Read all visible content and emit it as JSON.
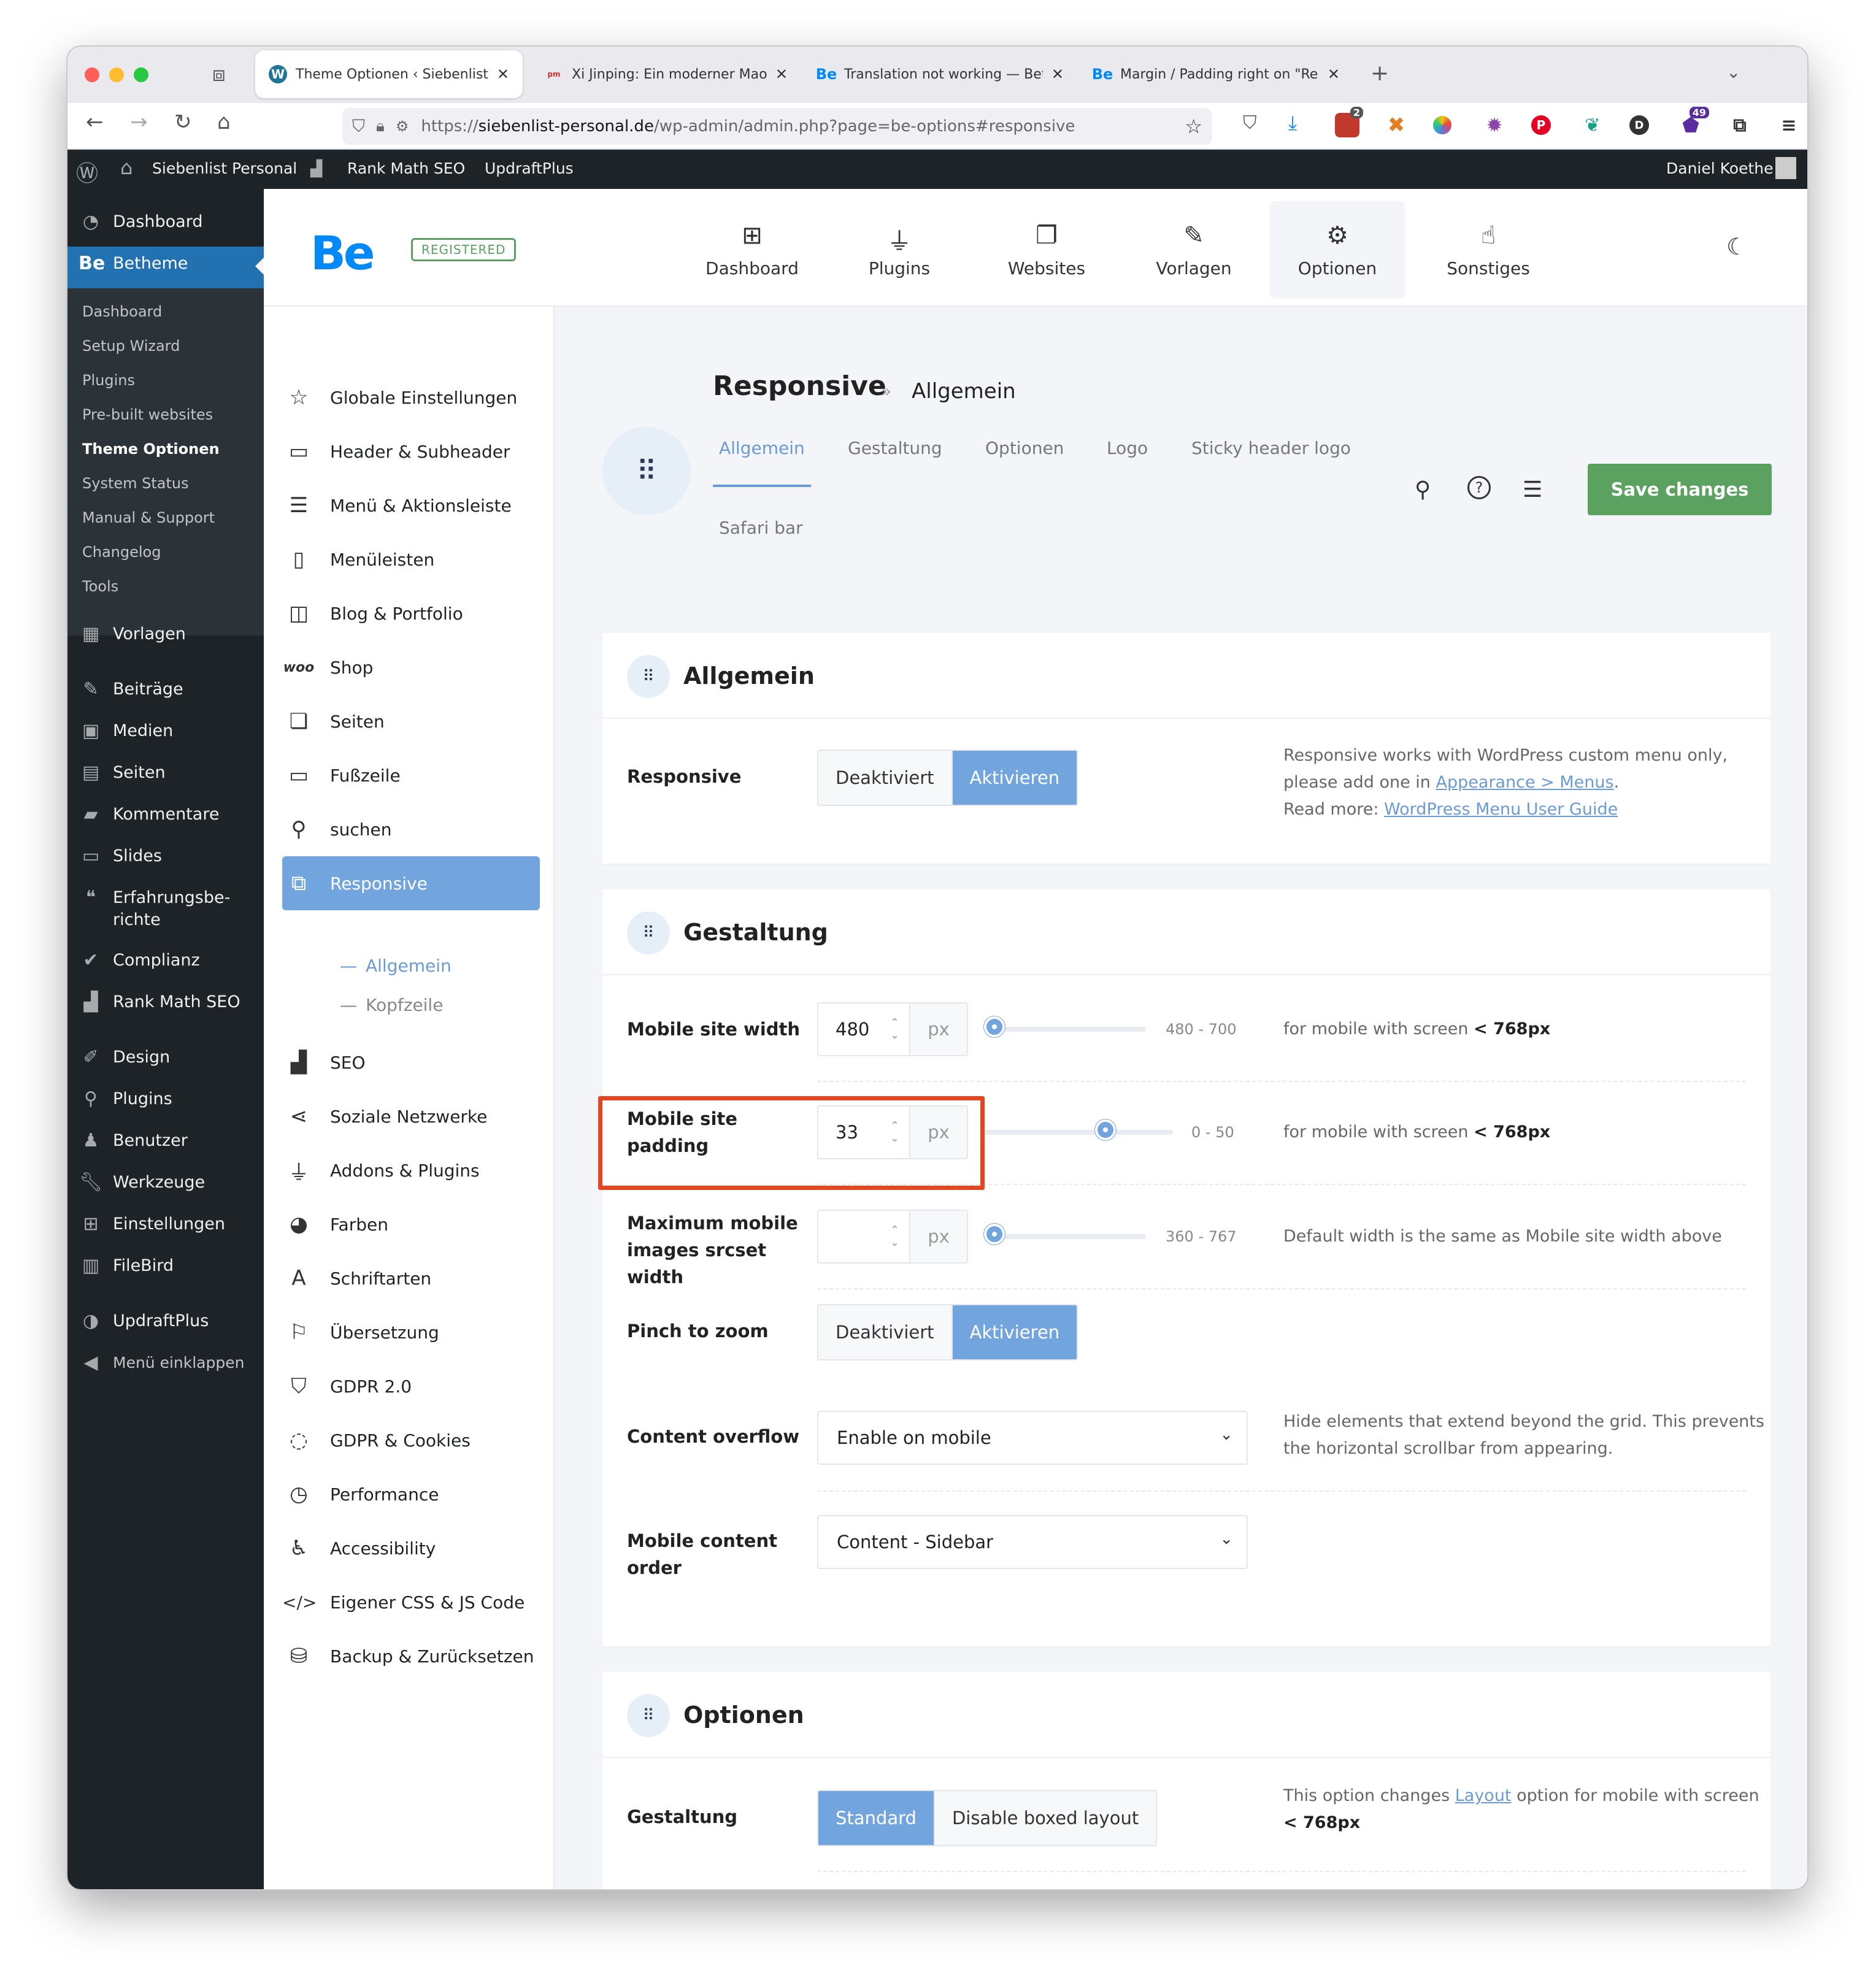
{
  "browser": {
    "tabs": [
      {
        "title": "Theme Optionen ‹ Siebenlist Pe",
        "active": true,
        "favicon": "wordpress-icon"
      },
      {
        "title": "Xi Jinping: Ein moderner Mao Ze",
        "active": false,
        "favicon": "news-icon"
      },
      {
        "title": "Translation not working — Betheme",
        "active": false,
        "favicon": "Be"
      },
      {
        "title": "Margin / Padding right on \"Relat",
        "active": false,
        "favicon": "Be"
      }
    ],
    "url_prefix": "https://",
    "url_domain": "siebenlist-personal.de",
    "url_path": "/wp-admin/admin.php?page=be-options#responsive",
    "ext_badge_1": "2",
    "ext_badge_2": "49",
    "ext_avatar": "D"
  },
  "adminbar": {
    "site": "Siebenlist Personal",
    "rankmath": "Rank Math SEO",
    "updraft": "UpdraftPlus",
    "user": "Daniel Koethe"
  },
  "wp_menu": {
    "dashboard": "Dashboard",
    "betheme": "Betheme",
    "sub": [
      "Dashboard",
      "Setup Wizard",
      "Plugins",
      "Pre-built websites",
      "Theme Optionen",
      "System Status",
      "Manual & Support",
      "Changelog",
      "Tools"
    ],
    "vorlagen": "Vorlagen",
    "beitraege": "Beiträge",
    "medien": "Medien",
    "seiten": "Seiten",
    "kommentare": "Kommentare",
    "slides": "Slides",
    "erfahrung_1": "Erfahrungsbe-",
    "erfahrung_2": "richte",
    "complianz": "Complianz",
    "rankmath": "Rank Math SEO",
    "design": "Design",
    "plugins": "Plugins",
    "benutzer": "Benutzer",
    "werkzeuge": "Werkzeuge",
    "einstellungen": "Einstellungen",
    "filebird": "FileBird",
    "updraft": "UpdraftPlus",
    "collapse": "Menü einklappen"
  },
  "be_header": {
    "logo": "Be",
    "badge": "REGISTERED",
    "nav": [
      "Dashboard",
      "Plugins",
      "Websites",
      "Vorlagen",
      "Optionen",
      "Sonstiges"
    ]
  },
  "be_sidebar": {
    "items": [
      "Globale Einstellungen",
      "Header & Subheader",
      "Menü & Aktionsleiste",
      "Menüleisten",
      "Blog & Portfolio",
      "Shop",
      "Seiten",
      "Fußzeile",
      "suchen",
      "Responsive",
      "SEO",
      "Soziale Netzwerke",
      "Addons & Plugins",
      "Farben",
      "Schriftarten",
      "Übersetzung",
      "GDPR 2.0",
      "GDPR & Cookies",
      "Performance",
      "Accessibility",
      "Eigener CSS & JS Code",
      "Backup & Zurücksetzen"
    ],
    "woo_label": "woo",
    "responsive_sub": [
      "Allgemein",
      "Kopfzeile"
    ]
  },
  "main": {
    "crumb_title": "Responsive",
    "crumb_sep": "»",
    "crumb_current": "Allgemein",
    "subtabs": [
      "Allgemein",
      "Gestaltung",
      "Optionen",
      "Logo",
      "Sticky header logo",
      "Safari bar"
    ],
    "save": "Save changes"
  },
  "card_allgemein": {
    "title": "Allgemein",
    "responsive_label": "Responsive",
    "off": "Deaktiviert",
    "on": "Aktivieren",
    "desc_1": "Responsive works with WordPress custom menu only,",
    "desc_2_pre": "please add one in ",
    "desc_2_link": "Appearance > Menus",
    "desc_2_post": ".",
    "desc_3_pre": "Read more: ",
    "desc_3_link": "WordPress Menu User Guide"
  },
  "card_gestaltung": {
    "title": "Gestaltung",
    "width_label": "Mobile site width",
    "width_value": "480",
    "width_unit": "px",
    "width_range": "480 - 700",
    "width_level": 0,
    "width_desc_pre": "for mobile with screen ",
    "width_desc_b": "< 768px",
    "pad_label_1": "Mobile site",
    "pad_label_2": "padding",
    "pad_value": "33",
    "pad_unit": "px",
    "pad_range": "0 - 50",
    "pad_level": 0.66,
    "pad_desc_pre": "for mobile with screen ",
    "pad_desc_b": "< 768px",
    "img_label_1": "Maximum mobile",
    "img_label_2": "images srcset",
    "img_label_3": "width",
    "img_value": "",
    "img_unit": "px",
    "img_range": "360 - 767",
    "img_level": 0,
    "img_desc": "Default width is the same as Mobile site width above",
    "pinch_label": "Pinch to zoom",
    "pinch_off": "Deaktiviert",
    "pinch_on": "Aktivieren",
    "overflow_label": "Content overflow",
    "overflow_value": "Enable on mobile",
    "overflow_desc_1": "Hide elements that extend beyond the grid. This prevents",
    "overflow_desc_2": "the horizontal scrollbar from appearing.",
    "order_label_1": "Mobile content",
    "order_label_2": "order",
    "order_value": "Content - Sidebar"
  },
  "card_optionen": {
    "title": "Optionen",
    "gest_label": "Gestaltung",
    "standard": "Standard",
    "disable": "Disable boxed layout",
    "desc_pre": "This option changes ",
    "desc_link": "Layout",
    "desc_post": " option for mobile with screen",
    "desc_b": "< 768px"
  },
  "colors": {
    "accent": "#72a5dd",
    "save": "#5ba160",
    "highlight": "#e64522",
    "wp_blue": "#2271b1"
  }
}
